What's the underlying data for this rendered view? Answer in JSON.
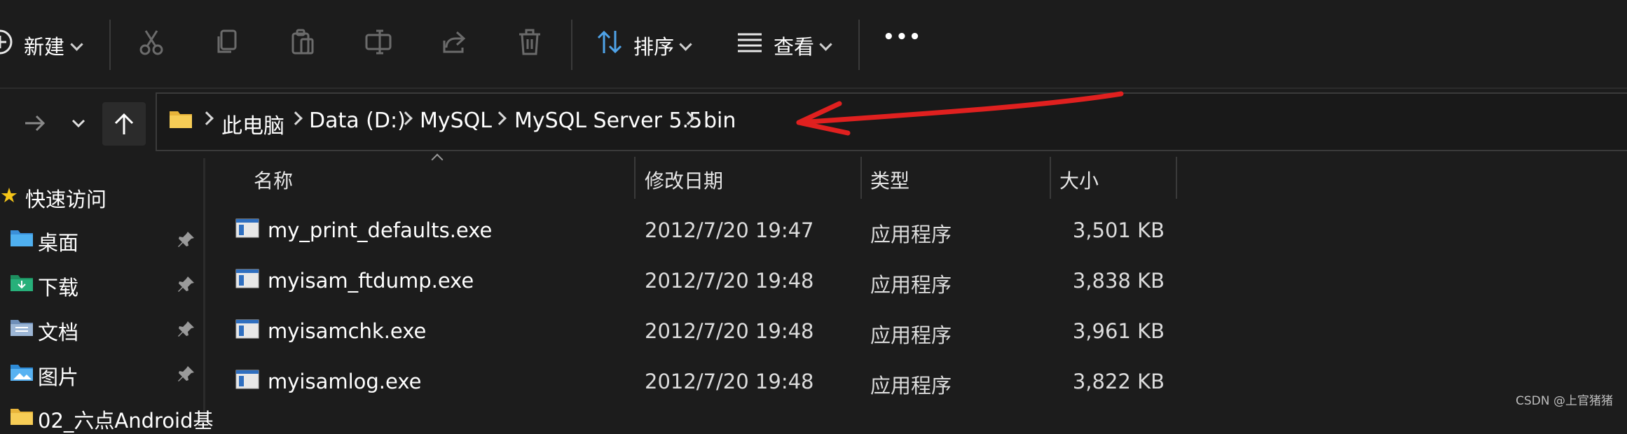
{
  "toolbar": {
    "new_label": "新建",
    "sort_label": "排序",
    "view_label": "查看",
    "more_label": "•••"
  },
  "address": {
    "crumbs": [
      "此电脑",
      "Data (D:)",
      "MySQL",
      "MySQL Server 5.5",
      "bin"
    ]
  },
  "annotation_color": "#e0201f",
  "sidebar": {
    "quick_access": "快速访问",
    "items": [
      {
        "label": "桌面"
      },
      {
        "label": "下载"
      },
      {
        "label": "文档"
      },
      {
        "label": "图片"
      },
      {
        "label": "02_六点Android基"
      }
    ]
  },
  "columns": {
    "name": "名称",
    "modified": "修改日期",
    "type": "类型",
    "size": "大小"
  },
  "files": [
    {
      "name": "my_print_defaults.exe",
      "modified": "2012/7/20 19:47",
      "type": "应用程序",
      "size": "3,501 KB"
    },
    {
      "name": "myisam_ftdump.exe",
      "modified": "2012/7/20 19:48",
      "type": "应用程序",
      "size": "3,838 KB"
    },
    {
      "name": "myisamchk.exe",
      "modified": "2012/7/20 19:48",
      "type": "应用程序",
      "size": "3,961 KB"
    },
    {
      "name": "myisamlog.exe",
      "modified": "2012/7/20 19:48",
      "type": "应用程序",
      "size": "3,822 KB"
    }
  ],
  "watermark": "CSDN @上官猪猪"
}
